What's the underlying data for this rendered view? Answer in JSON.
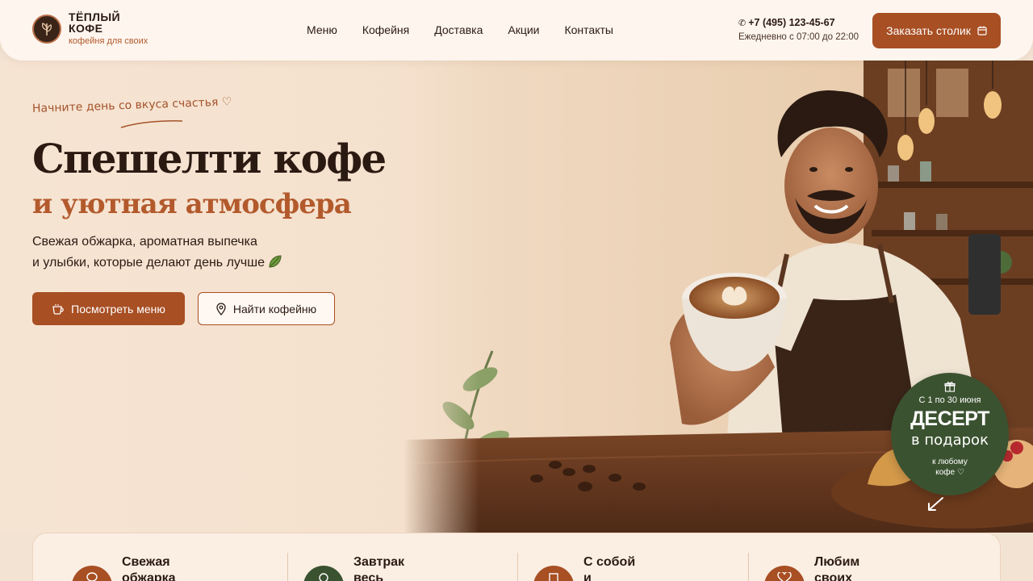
{
  "brand": {
    "title": "ТЁПЛЫЙ КОФЕ",
    "subtitle": "кофейня для своих"
  },
  "nav": [
    "Меню",
    "Кофейня",
    "Доставка",
    "Акции",
    "Контакты"
  ],
  "contact": {
    "phone": "+7 (495) 123-45-67",
    "hours": "Ежедневно с 07:00 до 22:00"
  },
  "header_cta": "Заказать столик",
  "hero": {
    "tagline": "Начните день со вкуса счастья ♡",
    "title": "Спешелти кофе",
    "subtitle": "и уютная атмосфера",
    "lead_line1": "Свежая обжарка, ароматная выпечка",
    "lead_line2": "и улыбки, которые делают день лучше",
    "btn_menu": "Посмотреть меню",
    "btn_find": "Найти кофейню"
  },
  "promo": {
    "date": "С 1 по 30 июня",
    "headline": "ДЕСЕРТ",
    "sub": "в подарок",
    "small_line1": "к любому",
    "small_line2": "кофе ♡"
  },
  "features": [
    {
      "line1": "Свежая",
      "line2": "обжарка"
    },
    {
      "line1": "Завтрак",
      "line2": "весь день"
    },
    {
      "line1": "С собой",
      "line2": "и доставка"
    },
    {
      "line1": "Любим",
      "line2": "своих гостей"
    }
  ],
  "colors": {
    "accent": "#a84f24",
    "accent_text": "#b35a2c",
    "dark": "#2b1a12",
    "promo_green": "#3b5230",
    "header_bg": "#fdf5ee"
  },
  "icons": {
    "logo": "coffee-bean-leaf-icon",
    "phone": "phone-icon",
    "calendar": "calendar-icon",
    "cup": "coffee-cup-icon",
    "pin": "map-pin-icon",
    "gift": "gift-icon",
    "leaf": "leaf-icon"
  }
}
